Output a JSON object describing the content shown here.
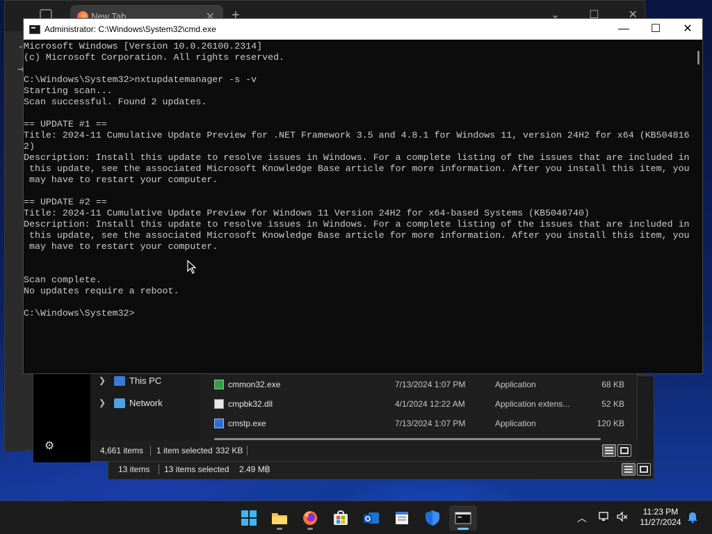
{
  "browser": {
    "tab_title": "New Tab",
    "tab_close": "✕",
    "new_tab": "+"
  },
  "cmd": {
    "title": "Administrator: C:\\Windows\\System32\\cmd.exe",
    "minimize": "—",
    "maximize": "☐",
    "close": "✕",
    "lines": [
      "Microsoft Windows [Version 10.0.26100.2314]",
      "(c) Microsoft Corporation. All rights reserved.",
      "",
      "C:\\Windows\\System32>nxtupdatemanager -s -v",
      "Starting scan...",
      "Scan successful. Found 2 updates.",
      "",
      "== UPDATE #1 ==",
      "Title: 2024-11 Cumulative Update Preview for .NET Framework 3.5 and 4.8.1 for Windows 11, version 24H2 for x64 (KB504816",
      "2)",
      "Description: Install this update to resolve issues in Windows. For a complete listing of the issues that are included in",
      " this update, see the associated Microsoft Knowledge Base article for more information. After you install this item, you",
      " may have to restart your computer.",
      "",
      "== UPDATE #2 ==",
      "Title: 2024-11 Cumulative Update Preview for Windows 11 Version 24H2 for x64-based Systems (KB5046740)",
      "Description: Install this update to resolve issues in Windows. For a complete listing of the issues that are included in",
      " this update, see the associated Microsoft Knowledge Base article for more information. After you install this item, you",
      " may have to restart your computer.",
      "",
      "",
      "Scan complete.",
      "No updates require a reboot.",
      "",
      "C:\\Windows\\System32>"
    ]
  },
  "explorer_front": {
    "nav": [
      {
        "label": "This PC",
        "icon": "pc-icon"
      },
      {
        "label": "Network",
        "icon": "network-icon"
      }
    ],
    "files": [
      {
        "name": "cmmon32.exe",
        "date": "7/13/2024 1:07 PM",
        "type": "Application",
        "size": "68 KB"
      },
      {
        "name": "cmpbk32.dll",
        "date": "4/1/2024 12:22 AM",
        "type": "Application extens...",
        "size": "52 KB"
      },
      {
        "name": "cmstp.exe",
        "date": "7/13/2024 1:07 PM",
        "type": "Application",
        "size": "120 KB"
      }
    ],
    "status": {
      "items": "4,661 items",
      "selected": "1 item selected",
      "size": "332 KB"
    }
  },
  "explorer_back": {
    "status": {
      "items": "13 items",
      "selected": "13 items selected",
      "size": "2.49 MB"
    }
  },
  "taskbar": {
    "apps": [
      "start-icon",
      "file-explorer-icon",
      "firefox-icon",
      "microsoft-store-icon",
      "outlook-icon",
      "notepad-icon",
      "defender-icon",
      "terminal-icon"
    ],
    "time": "11:23 PM",
    "date": "11/27/2024"
  },
  "colors": {
    "console_bg": "#0c0c0c",
    "console_fg": "#cccccc",
    "accent": "#6cc6ff"
  }
}
